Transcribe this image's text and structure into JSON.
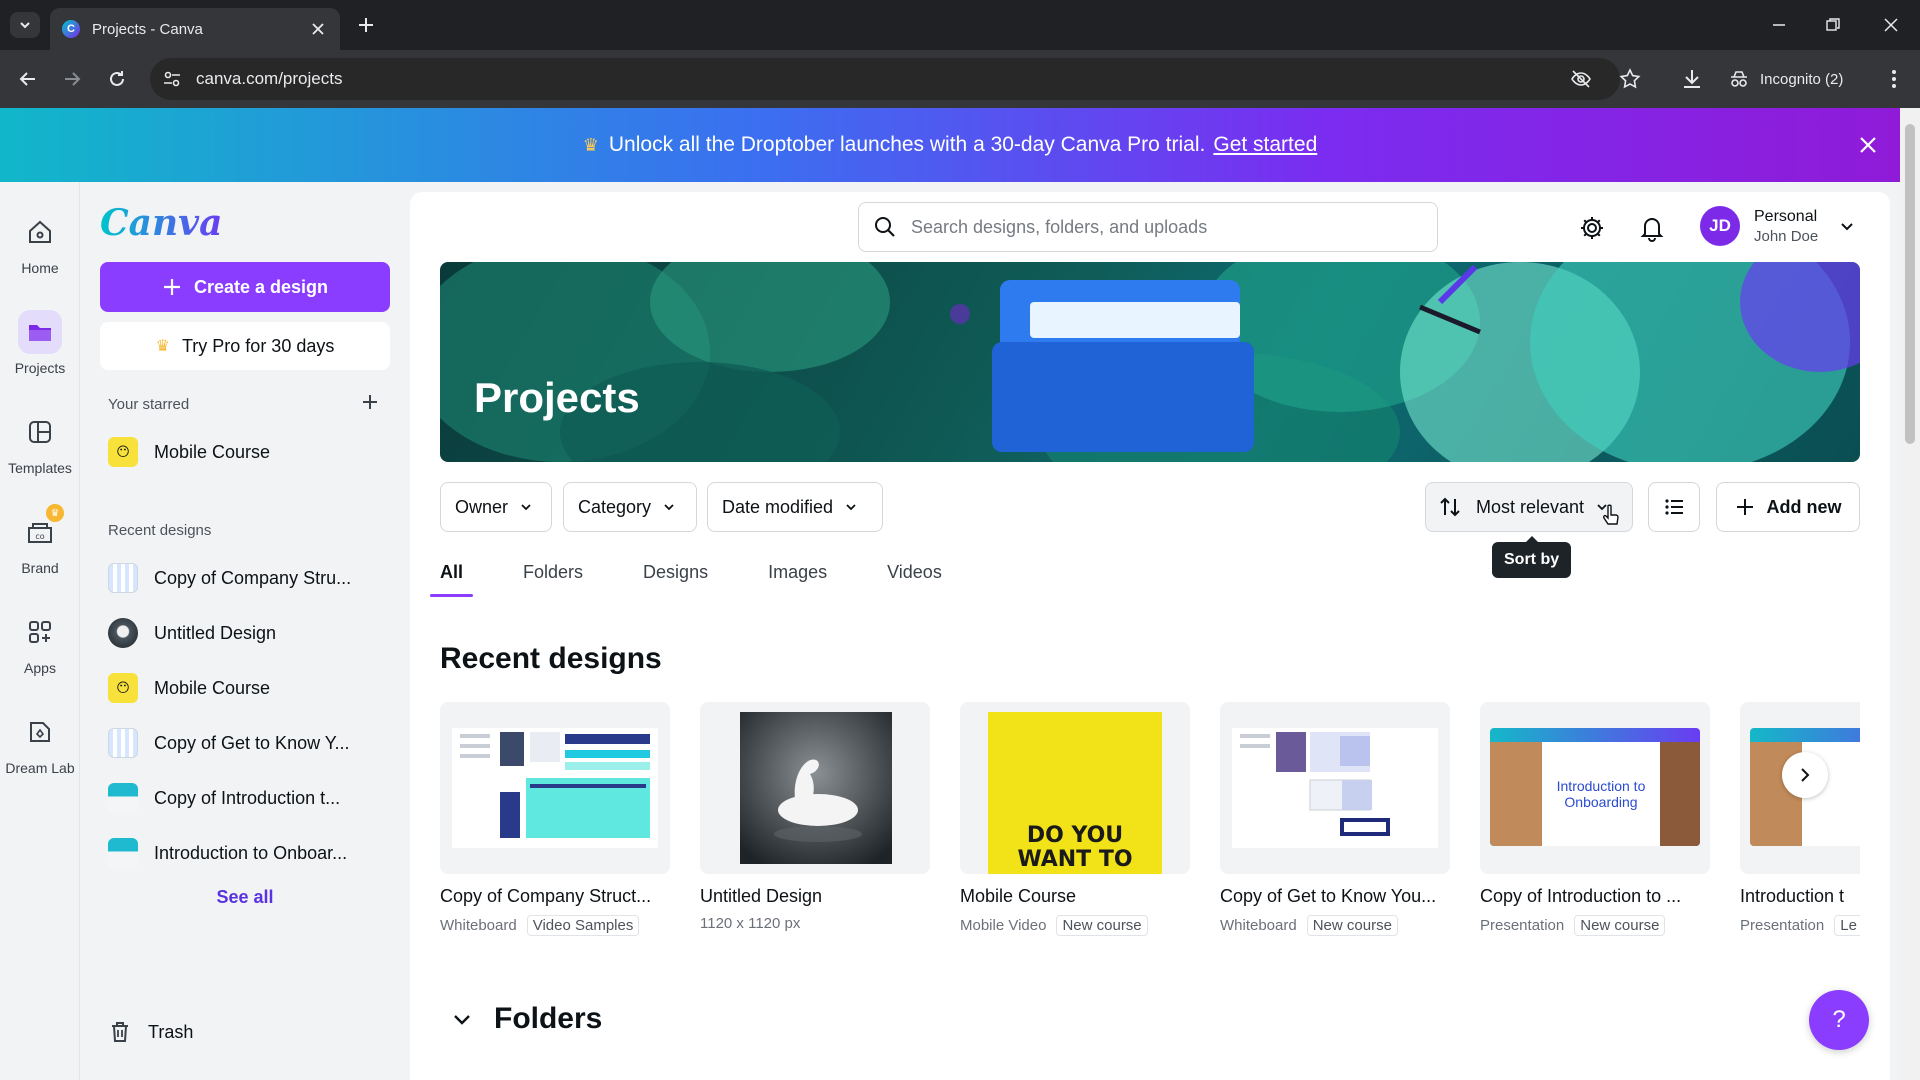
{
  "browser": {
    "tab_title": "Projects - Canva",
    "favicon_letter": "C",
    "url": "canva.com/projects",
    "incognito_label": "Incognito (2)"
  },
  "promo": {
    "message": "Unlock all the Droptober launches with a 30-day Canva Pro trial.",
    "link": "Get started"
  },
  "rail": {
    "items": [
      {
        "label": "Home",
        "icon": "home-icon"
      },
      {
        "label": "Projects",
        "icon": "folder-icon"
      },
      {
        "label": "Templates",
        "icon": "templates-icon"
      },
      {
        "label": "Brand",
        "icon": "brand-icon"
      },
      {
        "label": "Apps",
        "icon": "apps-icon"
      },
      {
        "label": "Dream Lab",
        "icon": "dream-lab-icon"
      }
    ]
  },
  "sidebar": {
    "logo": "Canva",
    "create_label": "Create a design",
    "trypro_label": "Try Pro for 30 days",
    "starred_label": "Your starred",
    "starred": [
      {
        "label": "Mobile Course"
      }
    ],
    "recent_label": "Recent designs",
    "recent": [
      {
        "label": "Copy of Company Stru..."
      },
      {
        "label": "Untitled Design"
      },
      {
        "label": "Mobile Course"
      },
      {
        "label": "Copy of Get to Know Y..."
      },
      {
        "label": "Copy of Introduction t..."
      },
      {
        "label": "Introduction to Onboar..."
      }
    ],
    "see_all": "See all",
    "trash_label": "Trash"
  },
  "header": {
    "search_placeholder": "Search designs, folders, and uploads",
    "account_type": "Personal",
    "account_name": "John Doe",
    "avatar_initials": "JD"
  },
  "hero": {
    "title": "Projects"
  },
  "filters": {
    "owner": "Owner",
    "category": "Category",
    "date_modified": "Date modified",
    "sort_label": "Most relevant",
    "sort_tooltip": "Sort by",
    "add_new": "Add new"
  },
  "tabs": [
    {
      "label": "All",
      "active": true
    },
    {
      "label": "Folders",
      "active": false
    },
    {
      "label": "Designs",
      "active": false
    },
    {
      "label": "Images",
      "active": false
    },
    {
      "label": "Videos",
      "active": false
    }
  ],
  "recent_section_title": "Recent designs",
  "designs": [
    {
      "title": "Copy of Company Struct...",
      "type": "Whiteboard",
      "tag": "Video Samples"
    },
    {
      "title": "Untitled Design",
      "type": "1120 x 1120 px",
      "tag": ""
    },
    {
      "title": "Mobile Course",
      "type": "Mobile Video",
      "tag": "New course",
      "thumb_text": "DO YOU WANT TO"
    },
    {
      "title": "Copy of Get to Know You...",
      "type": "Whiteboard",
      "tag": "New course"
    },
    {
      "title": "Copy of Introduction to ...",
      "type": "Presentation",
      "tag": "New course",
      "thumb_text": "Introduction to Onboarding"
    },
    {
      "title": "Introduction t",
      "type": "Presentation",
      "tag": "Le"
    }
  ],
  "folders_title": "Folders",
  "help_label": "?",
  "colors": {
    "accent": "#8b3dff",
    "promo_start": "#11b7c9",
    "promo_end": "#8f1bd8"
  }
}
